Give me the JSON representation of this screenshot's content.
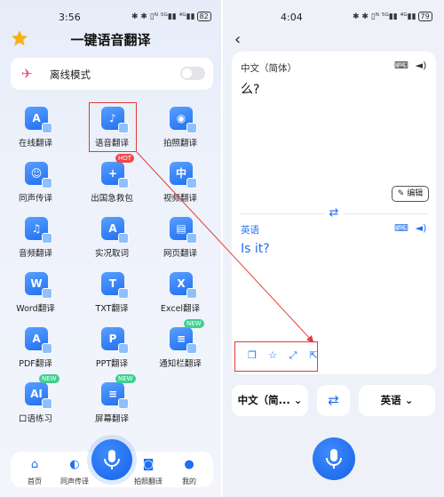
{
  "left": {
    "status": {
      "time": "3:56",
      "icons": "✱ ✱ ▯ᴺ ⁵ᴳ▮▮ ⁴ᴳ▮▮",
      "battery": "82"
    },
    "title": "一键语音翻译",
    "offline": {
      "label": "离线模式",
      "enabled": false
    },
    "tools": [
      {
        "label": "在线翻译",
        "glyph": "A",
        "badge": ""
      },
      {
        "label": "语音翻译",
        "glyph": "♪",
        "badge": ""
      },
      {
        "label": "拍照翻译",
        "glyph": "◉",
        "badge": ""
      },
      {
        "label": "同声传译",
        "glyph": "☺",
        "badge": ""
      },
      {
        "label": "出国急救包",
        "glyph": "+",
        "badge": "HOT"
      },
      {
        "label": "视频翻译",
        "glyph": "中",
        "badge": ""
      },
      {
        "label": "音频翻译",
        "glyph": "♫",
        "badge": ""
      },
      {
        "label": "实况取词",
        "glyph": "A",
        "badge": ""
      },
      {
        "label": "网页翻译",
        "glyph": "▤",
        "badge": ""
      },
      {
        "label": "Word翻译",
        "glyph": "W",
        "badge": ""
      },
      {
        "label": "TXT翻译",
        "glyph": "T",
        "badge": ""
      },
      {
        "label": "Excel翻译",
        "glyph": "X",
        "badge": ""
      },
      {
        "label": "PDF翻译",
        "glyph": "A",
        "badge": ""
      },
      {
        "label": "PPT翻译",
        "glyph": "P",
        "badge": ""
      },
      {
        "label": "通知栏翻译",
        "glyph": "≡",
        "badge": "NEW"
      },
      {
        "label": "口语练习",
        "glyph": "AI",
        "badge": "NEW"
      },
      {
        "label": "屏幕翻译",
        "glyph": "≡",
        "badge": "NEW"
      }
    ],
    "nav": [
      {
        "label": "首页",
        "icon": "home-icon",
        "glyph": "⌂"
      },
      {
        "label": "同声传译",
        "icon": "simul-icon",
        "glyph": "◐"
      },
      {
        "label": "拍照翻译",
        "icon": "camera-icon",
        "glyph": "◙"
      },
      {
        "label": "我的",
        "icon": "profile-icon",
        "glyph": "●"
      }
    ]
  },
  "right": {
    "status": {
      "time": "4:04",
      "icons": "✱ ✱ ▯ᴺ ⁵ᴳ▮▮ ⁴ᴳ▮▮",
      "battery": "79"
    },
    "source_lang": "中文（简体）",
    "source_text": "么?",
    "edit_label": "编辑",
    "target_lang": "英语",
    "target_text": "Is it?",
    "from_pill": "中文（简...",
    "to_pill": "英语"
  },
  "colors": {
    "accent": "#1f6ff2",
    "highlight_box": "#e33b3b",
    "badge_hot": "#f04848",
    "badge_new": "#3ecf8e"
  }
}
